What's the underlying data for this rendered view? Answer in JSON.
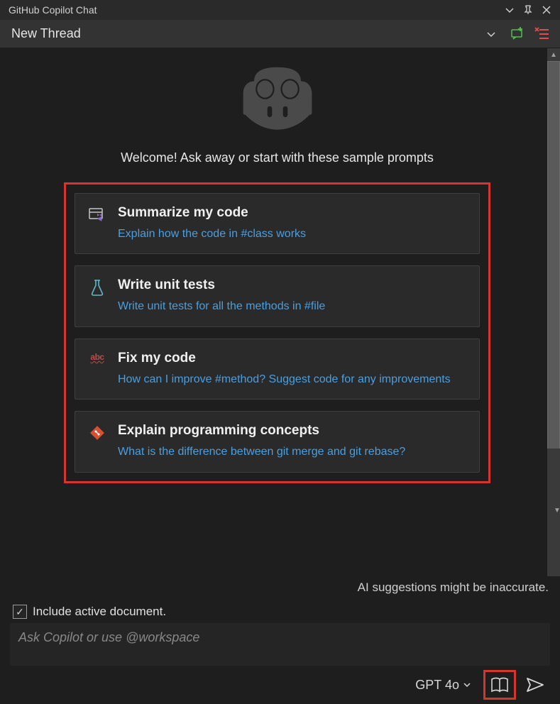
{
  "titlebar": {
    "title": "GitHub Copilot Chat"
  },
  "threadbar": {
    "title": "New Thread"
  },
  "welcome": "Welcome! Ask away or start with these sample prompts",
  "cards": [
    {
      "title": "Summarize my code",
      "desc": "Explain how the code in #class works"
    },
    {
      "title": "Write unit tests",
      "desc": "Write unit tests for all the methods in #file"
    },
    {
      "title": "Fix my code",
      "desc": "How can I improve #method? Suggest code for any improvements"
    },
    {
      "title": "Explain programming concepts",
      "desc": "What is the difference between git merge and git rebase?"
    }
  ],
  "disclaimer": "AI suggestions might be inaccurate.",
  "include_doc": {
    "label": "Include active document.",
    "checked": true
  },
  "input": {
    "placeholder": "Ask Copilot or use @workspace"
  },
  "model": "GPT 4o",
  "icons": {
    "abc": "abc"
  }
}
